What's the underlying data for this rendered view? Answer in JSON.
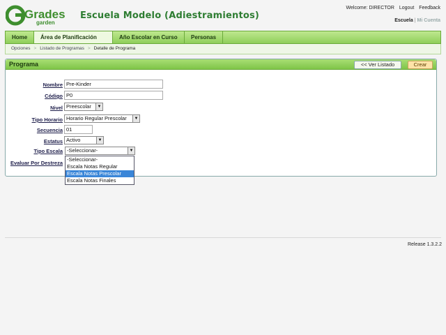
{
  "logo": {
    "main": "Grades",
    "sub": "garden"
  },
  "app_title": "Escuela Modelo (Adiestramientos)",
  "top": {
    "welcome": "Welcome: DIRECTOR",
    "logout": "Logout",
    "feedback": "Feedback",
    "school": "Escuela",
    "account": "Mi Cuenta"
  },
  "nav": {
    "tabs": [
      {
        "label": "Home"
      },
      {
        "label": "Área de Planificación"
      },
      {
        "label": "Año Escolar en Curso"
      },
      {
        "label": "Personas"
      }
    ]
  },
  "breadcrumb": [
    "Opciones",
    "Listado de Programas",
    "Detalle de Programa"
  ],
  "panel": {
    "title": "Programa",
    "list_button": "<< Ver Listado",
    "create_button": "Crear"
  },
  "form": {
    "nombre": {
      "label": "Nombre",
      "value": "Pre-Kinder"
    },
    "codigo": {
      "label": "Código",
      "value": "P0"
    },
    "nivel": {
      "label": "Nivel",
      "value": "Preescolar"
    },
    "tipo_horario": {
      "label": "Tipo Horario",
      "value": "Horario Regular Prescolar"
    },
    "secuencia": {
      "label": "Secuencia",
      "value": "01"
    },
    "estatus": {
      "label": "Estatus",
      "value": "Activo"
    },
    "tipo_escala": {
      "label": "Tipo Escala",
      "value": "-Seleccionar-"
    },
    "evaluar": {
      "label": "Evaluar Por Destreza"
    }
  },
  "escala_options": [
    "-Seleccionar-",
    "Escala Notas Regular",
    "Escala Notas Prescolar",
    "Escala Notas Finales"
  ],
  "escala_highlighted": "Escala Notas Prescolar",
  "footer": {
    "release": "Release 1.3.2.2"
  },
  "colors": {
    "brand_green": "#2e7d32",
    "nav_green": "#8fcf5a",
    "highlight": "#3a86d8",
    "create_button": "#fde3a8"
  }
}
